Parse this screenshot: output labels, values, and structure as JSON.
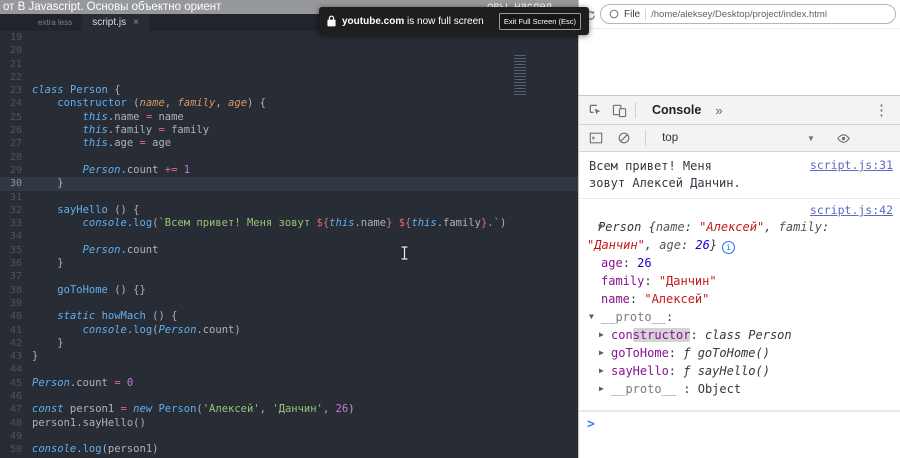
{
  "video_title": {
    "left_fragment": "от В Javascript. Основы объектно ориент",
    "right_fragment": "овы, наслед"
  },
  "notification": {
    "site": "youtube.com",
    "message": " is now full screen",
    "button_label": "Exit Full Screen (Esc)"
  },
  "browser": {
    "scheme_label": "File",
    "path": "/home/aleksey/Desktop/project/index.html"
  },
  "editor": {
    "tabs": [
      {
        "label": "extra less"
      },
      {
        "label": "script.js",
        "close_glyph": "×"
      }
    ],
    "lines": [
      {
        "n": 19,
        "s": []
      },
      {
        "n": 20,
        "s": []
      },
      {
        "n": 21,
        "s": []
      },
      {
        "n": 22,
        "s": []
      },
      {
        "n": 23,
        "s": [
          [
            "kw",
            "class"
          ],
          [
            "pl",
            " "
          ],
          [
            "cls",
            "Person"
          ],
          [
            "pl",
            " {"
          ]
        ]
      },
      {
        "n": 24,
        "s": [
          [
            "pl",
            "    "
          ],
          [
            "fn",
            "constructor"
          ],
          [
            "pl",
            " ("
          ],
          [
            "pm",
            "name"
          ],
          [
            "pl",
            ", "
          ],
          [
            "pm",
            "family"
          ],
          [
            "pl",
            ", "
          ],
          [
            "pm",
            "age"
          ],
          [
            "pl",
            ") {"
          ]
        ]
      },
      {
        "n": 25,
        "s": [
          [
            "pl",
            "        "
          ],
          [
            "th",
            "this"
          ],
          [
            "pl",
            ".name "
          ],
          [
            "op",
            "="
          ],
          [
            "pl",
            " name"
          ]
        ]
      },
      {
        "n": 26,
        "s": [
          [
            "pl",
            "        "
          ],
          [
            "th",
            "this"
          ],
          [
            "pl",
            ".family "
          ],
          [
            "op",
            "="
          ],
          [
            "pl",
            " family"
          ]
        ]
      },
      {
        "n": 27,
        "s": [
          [
            "pl",
            "        "
          ],
          [
            "th",
            "this"
          ],
          [
            "pl",
            ".age "
          ],
          [
            "op",
            "="
          ],
          [
            "pl",
            " age"
          ]
        ]
      },
      {
        "n": 28,
        "s": []
      },
      {
        "n": 29,
        "s": [
          [
            "pl",
            "        "
          ],
          [
            "ci",
            "Person"
          ],
          [
            "pl",
            ".count "
          ],
          [
            "op",
            "+="
          ],
          [
            "pl",
            " "
          ],
          [
            "num",
            "1"
          ]
        ]
      },
      {
        "n": 30,
        "hl": true,
        "s": [
          [
            "pl",
            "    }"
          ]
        ]
      },
      {
        "n": 31,
        "s": []
      },
      {
        "n": 32,
        "s": [
          [
            "pl",
            "    "
          ],
          [
            "fn",
            "sayHello"
          ],
          [
            "pl",
            " () {"
          ]
        ]
      },
      {
        "n": 33,
        "s": [
          [
            "pl",
            "        "
          ],
          [
            "th",
            "console"
          ],
          [
            "pl",
            "."
          ],
          [
            "fn",
            "log"
          ],
          [
            "pl",
            "("
          ],
          [
            "str",
            "`Всем привет! Меня зовут "
          ],
          [
            "op",
            "${"
          ],
          [
            "th",
            "this"
          ],
          [
            "pl",
            ".name"
          ],
          [
            "op",
            "}"
          ],
          [
            "str",
            " "
          ],
          [
            "op",
            "${"
          ],
          [
            "th",
            "this"
          ],
          [
            "pl",
            ".family"
          ],
          [
            "op",
            "}"
          ],
          [
            "str",
            ".`"
          ],
          [
            "pl",
            ")"
          ]
        ]
      },
      {
        "n": 34,
        "s": []
      },
      {
        "n": 35,
        "s": [
          [
            "pl",
            "        "
          ],
          [
            "ci",
            "Person"
          ],
          [
            "pl",
            ".count"
          ]
        ]
      },
      {
        "n": 36,
        "s": [
          [
            "pl",
            "    }"
          ]
        ]
      },
      {
        "n": 37,
        "s": []
      },
      {
        "n": 38,
        "s": [
          [
            "pl",
            "    "
          ],
          [
            "fn",
            "goToHome"
          ],
          [
            "pl",
            " () {}"
          ]
        ]
      },
      {
        "n": 39,
        "s": []
      },
      {
        "n": 40,
        "s": [
          [
            "pl",
            "    "
          ],
          [
            "kw",
            "static"
          ],
          [
            "pl",
            " "
          ],
          [
            "fn",
            "howMach"
          ],
          [
            "pl",
            " () {"
          ]
        ]
      },
      {
        "n": 41,
        "s": [
          [
            "pl",
            "        "
          ],
          [
            "th",
            "console"
          ],
          [
            "pl",
            "."
          ],
          [
            "fn",
            "log"
          ],
          [
            "pl",
            "("
          ],
          [
            "ci",
            "Person"
          ],
          [
            "pl",
            ".count)"
          ]
        ]
      },
      {
        "n": 42,
        "s": [
          [
            "pl",
            "    }"
          ]
        ]
      },
      {
        "n": 43,
        "s": [
          [
            "pl",
            "}"
          ]
        ]
      },
      {
        "n": 44,
        "s": []
      },
      {
        "n": 45,
        "s": [
          [
            "ci",
            "Person"
          ],
          [
            "pl",
            ".count "
          ],
          [
            "op",
            "="
          ],
          [
            "pl",
            " "
          ],
          [
            "num",
            "0"
          ]
        ]
      },
      {
        "n": 46,
        "s": []
      },
      {
        "n": 47,
        "s": [
          [
            "kw",
            "const"
          ],
          [
            "pl",
            " person1 "
          ],
          [
            "op",
            "="
          ],
          [
            "pl",
            " "
          ],
          [
            "kw",
            "new"
          ],
          [
            "pl",
            " "
          ],
          [
            "cls",
            "Person"
          ],
          [
            "pl",
            "("
          ],
          [
            "str",
            "'Алексей'"
          ],
          [
            "pl",
            ", "
          ],
          [
            "str",
            "'Данчин'"
          ],
          [
            "pl",
            ", "
          ],
          [
            "num",
            "26"
          ],
          [
            "pl",
            ")"
          ]
        ]
      },
      {
        "n": 48,
        "s": [
          [
            "pl",
            "person1.sayHello()"
          ]
        ]
      },
      {
        "n": 49,
        "s": []
      },
      {
        "n": 50,
        "s": [
          [
            "th",
            "console"
          ],
          [
            "pl",
            "."
          ],
          [
            "fn",
            "log"
          ],
          [
            "pl",
            "(person1)"
          ]
        ]
      }
    ]
  },
  "devtools": {
    "console_tab_label": "Console",
    "more_tabs_glyph": "»",
    "menu_glyph": "⋮",
    "toolbar": {
      "context_value": "top",
      "dropdown_glyph": "▼"
    },
    "console": {
      "message1": {
        "text": "Всем привет! Меня зовут Алексей Данчин.",
        "link": "script.js:31"
      },
      "message2": {
        "link": "script.js:42"
      },
      "object_rows": [
        {
          "i": 0,
          "a": "d",
          "icon": true,
          "s": [
            [
              "cn",
              "Person"
            ],
            [
              "pp",
              " {"
            ],
            [
              "pk",
              "name"
            ],
            [
              "pp",
              ": "
            ],
            [
              "ps",
              "\"Алексей\""
            ],
            [
              "pp",
              ", "
            ],
            [
              "pk",
              "family"
            ],
            [
              "pp",
              ": "
            ],
            [
              "ps",
              "\"Данчин\""
            ],
            [
              "pp",
              ", "
            ],
            [
              "pk",
              "age"
            ],
            [
              "pp",
              ": "
            ],
            [
              "pn",
              "26"
            ],
            [
              "pp",
              "}"
            ]
          ]
        },
        {
          "i": 1,
          "a": null,
          "s": [
            [
              "k",
              "age"
            ],
            [
              "p",
              ": "
            ],
            [
              "n",
              "26"
            ]
          ]
        },
        {
          "i": 1,
          "a": null,
          "s": [
            [
              "k",
              "family"
            ],
            [
              "p",
              ": "
            ],
            [
              "s2",
              "\"Данчин\""
            ]
          ]
        },
        {
          "i": 1,
          "a": null,
          "s": [
            [
              "k",
              "name"
            ],
            [
              "p",
              ": "
            ],
            [
              "s2",
              "\"Алексей\""
            ]
          ]
        },
        {
          "i": 1,
          "a": "d",
          "s": [
            [
              "dim",
              "__proto__"
            ],
            [
              "p",
              ":"
            ]
          ]
        },
        {
          "i": 2,
          "a": "r",
          "s": [
            [
              "k",
              "con"
            ],
            [
              "khl",
              "structor"
            ],
            [
              "p",
              ": "
            ],
            [
              "fs",
              "class Person"
            ]
          ]
        },
        {
          "i": 2,
          "a": "r",
          "s": [
            [
              "k",
              "goToHome"
            ],
            [
              "p",
              ": "
            ],
            [
              "fs",
              "ƒ goToHome()"
            ]
          ]
        },
        {
          "i": 2,
          "a": "r",
          "s": [
            [
              "k",
              "sayHello"
            ],
            [
              "p",
              ": "
            ],
            [
              "fs",
              "ƒ sayHello()"
            ]
          ]
        },
        {
          "i": 2,
          "a": "r",
          "s": [
            [
              "dim",
              "__proto__"
            ],
            [
              "p",
              " : "
            ],
            [
              "p",
              "Object"
            ]
          ]
        }
      ],
      "prompt_glyph": ">"
    }
  },
  "colors": {
    "editor_bg": "#282c34",
    "keyword": "#61afef",
    "string": "#98c379",
    "number": "#c678dd",
    "operator": "#e06c75",
    "console_key": "#881391",
    "console_string": "#c41a16",
    "console_number": "#1c00cf",
    "source_link": "#5c6bc0"
  }
}
